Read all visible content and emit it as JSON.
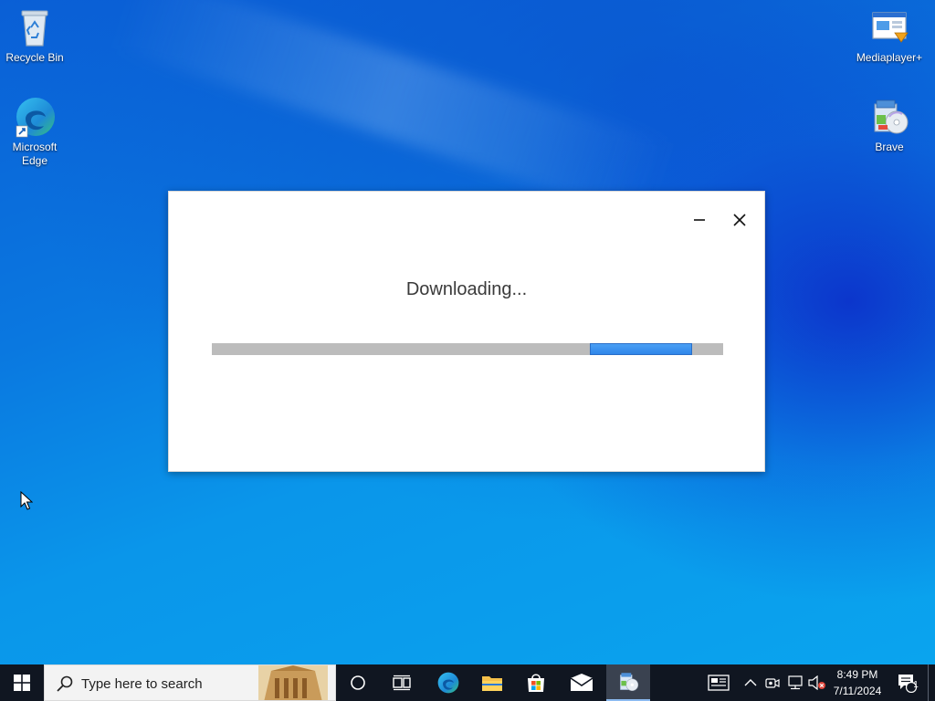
{
  "desktop": {
    "icons": [
      {
        "label": "Recycle Bin",
        "icon": "recycle-bin-icon"
      },
      {
        "label": "Microsoft Edge",
        "icon": "edge-icon"
      },
      {
        "label": "Mediaplayer+",
        "icon": "mediaplayer-icon"
      },
      {
        "label": "Brave",
        "icon": "installer-cd-icon"
      }
    ]
  },
  "dialog": {
    "title": "Downloading...",
    "progress": {
      "start_fraction": 0.74,
      "end_fraction": 0.94
    },
    "minimize_symbol": "–",
    "close_symbol": "✕",
    "accent_color": "#2f86ea"
  },
  "taskbar": {
    "search_placeholder": "Type here to search",
    "apps": [
      "start-icon",
      "cortana-icon",
      "task-view-icon",
      "edge-icon",
      "file-explorer-icon",
      "store-icon",
      "mail-icon",
      "setup-app-icon"
    ],
    "tray": {
      "time": "8:49 PM",
      "date": "7/11/2024",
      "notification_count": "1"
    }
  }
}
